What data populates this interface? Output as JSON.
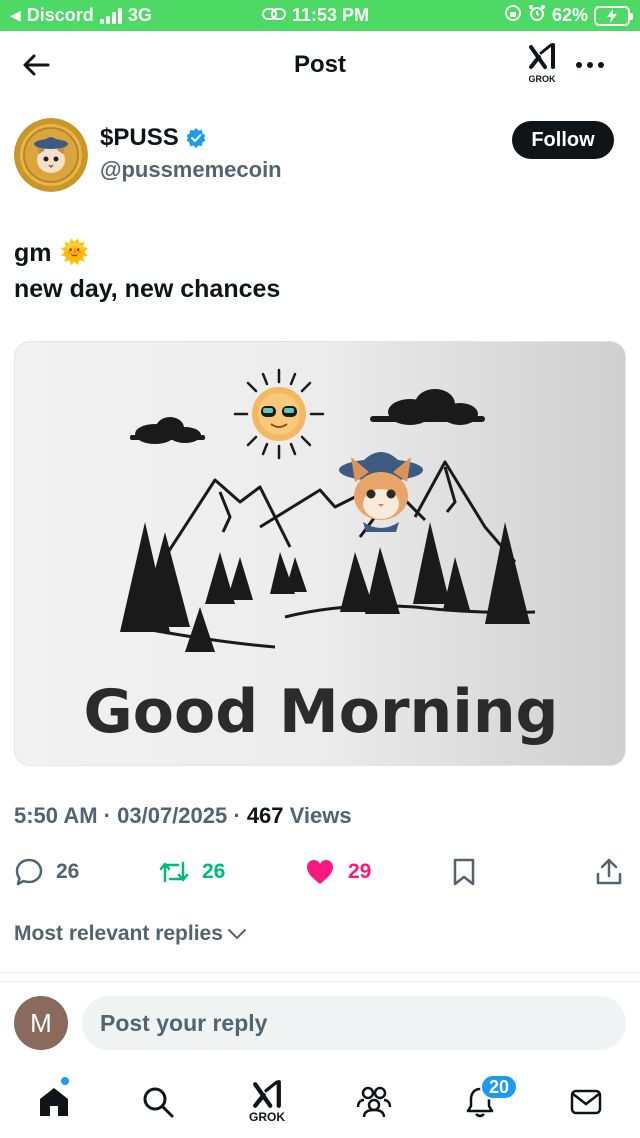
{
  "status_bar": {
    "back_app": "Discord",
    "network": "3G",
    "time": "11:53 PM",
    "battery": "62%"
  },
  "header": {
    "title": "Post",
    "grok_label": "GROK"
  },
  "author": {
    "display_name": "$PUSS",
    "handle": "@pussmemecoin",
    "verified": true,
    "follow_label": "Follow"
  },
  "post": {
    "line1": "gm",
    "line1_emoji": "🌞",
    "line2": "new day, new chances"
  },
  "media": {
    "headline": "Good Morning"
  },
  "meta": {
    "time": "5:50 AM",
    "separator": "·",
    "date": "03/07/2025",
    "views_count": "467",
    "views_label": "Views"
  },
  "actions": {
    "replies": "26",
    "reposts": "26",
    "likes": "29"
  },
  "replies_sort": "Most relevant replies",
  "reply_bar": {
    "avatar_letter": "M",
    "placeholder": "Post your reply"
  },
  "bottom_nav": {
    "grok_label": "GROK",
    "notifications_badge": "20"
  },
  "colors": {
    "status_green": "#4cd964",
    "accent_blue": "#1d9bf0",
    "repost_green": "#00ba7c",
    "like_pink": "#f91880"
  }
}
